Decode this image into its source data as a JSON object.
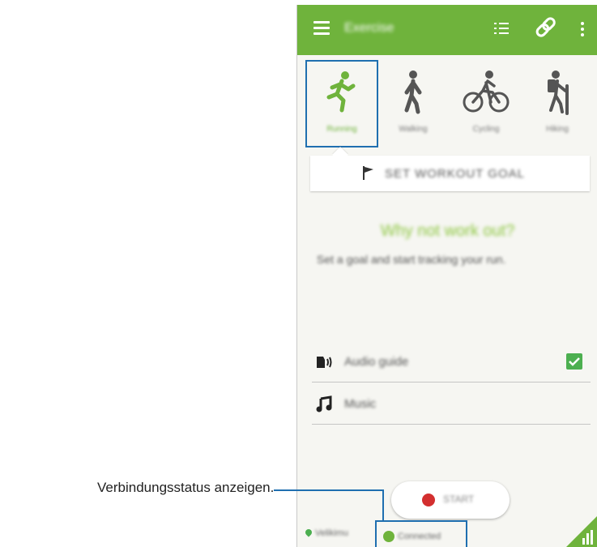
{
  "appbar": {
    "title": "Exercise",
    "link_glyph": "🔗"
  },
  "tabs": [
    {
      "label": "Running",
      "icon": "running-icon",
      "selected": true
    },
    {
      "label": "Walking",
      "icon": "walking-icon",
      "selected": false
    },
    {
      "label": "Cycling",
      "icon": "cycling-icon",
      "selected": false
    },
    {
      "label": "Hiking",
      "icon": "hiking-icon",
      "selected": false
    }
  ],
  "goal": {
    "label": "SET WORKOUT GOAL"
  },
  "prompt": {
    "heading": "Why not work out?",
    "subtext": "Set a goal and start tracking your run."
  },
  "options": [
    {
      "label": "Audio guide",
      "checked": true
    },
    {
      "label": "Music"
    }
  ],
  "start": {
    "label": "START"
  },
  "footer": {
    "location": "Velikimu",
    "connection": "Connected"
  },
  "callout": {
    "text": "Verbindungsstatus anzeigen."
  },
  "colors": {
    "accent": "#6fb33c",
    "highlight": "#1f6fb0",
    "record": "#d32f2f"
  }
}
